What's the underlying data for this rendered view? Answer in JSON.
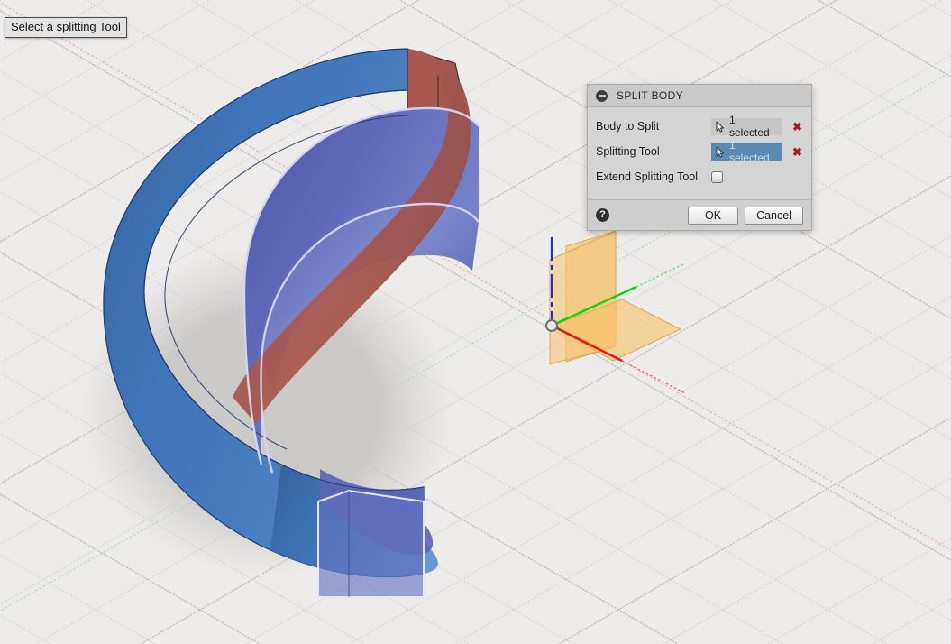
{
  "tooltip": {
    "text": "Select a splitting Tool"
  },
  "dialog": {
    "title": "SPLIT BODY",
    "collapse_icon": "minus-circle-icon",
    "rows": [
      {
        "label": "Body to Split",
        "field_value": "1 selected",
        "field_state": "inactive",
        "clear_glyph": "✖",
        "cursor_icon": "cursor-arrow-icon"
      },
      {
        "label": "Splitting Tool",
        "field_value": "1 selected",
        "field_state": "active",
        "clear_glyph": "✖",
        "cursor_icon": "cursor-arrow-icon"
      }
    ],
    "extend": {
      "label": "Extend Splitting Tool",
      "checked": false
    },
    "footer": {
      "help_glyph": "?",
      "ok_label": "OK",
      "cancel_label": "Cancel"
    }
  },
  "viewport": {
    "background_color": "#edecea",
    "grid_minor_color": "#cfcfcd",
    "grid_major_color": "#b9b9b7",
    "axes": {
      "x_color": "#e01b1b",
      "y_color": "#12d412",
      "z_color": "#1b30e0",
      "x_faint_color": "#e8a7a7",
      "y_faint_color": "#9fe29f",
      "origin_color": "#9a9a9a"
    },
    "origin_planes": {
      "fill": "#f5c06a",
      "stroke": "#e0a63f",
      "opacity": 0.62
    },
    "body": {
      "name": "spiral-ramp-body",
      "outer_face_color": "#3c6fb5",
      "inner_face_color": "#5a5eb0",
      "top_face_color": "#a0554f",
      "edge_color": "#1d3a6b",
      "highlight_edge_color": "#d6d4ec",
      "shadow_color": "#cdcccb"
    },
    "splitting_tool_plane": {
      "name": "splitting-tool-plane",
      "selected_fill": "#6672c4",
      "selected_stroke": "#e7e5f4",
      "selected_opacity": 0.72
    },
    "upper_cut_plane": {
      "name": "upper-cut-plane",
      "fill": "#a9564f",
      "stroke": "#2b2b2b"
    }
  }
}
